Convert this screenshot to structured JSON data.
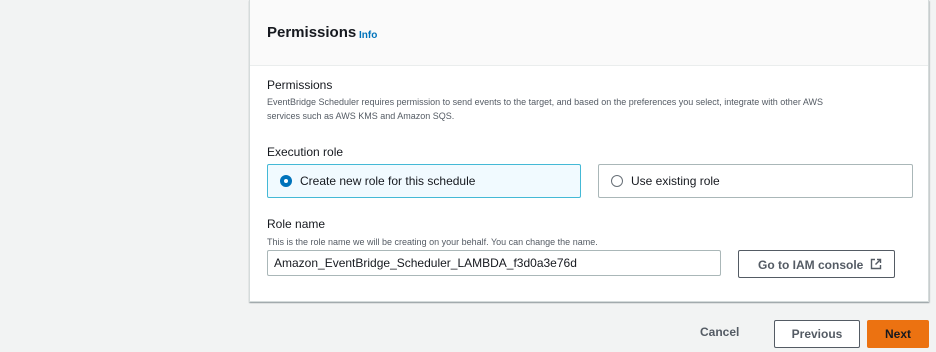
{
  "panel": {
    "title": "Permissions",
    "info_link": "Info"
  },
  "permissions": {
    "label": "Permissions",
    "description_line1": "EventBridge Scheduler requires permission to send events to the target, and based on the preferences you select, integrate with other AWS",
    "description_line2": "services such as AWS KMS and Amazon SQS."
  },
  "execution_role": {
    "label": "Execution role",
    "options": [
      {
        "label": "Create new role for this schedule",
        "selected": true
      },
      {
        "label": "Use existing role",
        "selected": false
      }
    ]
  },
  "role_name": {
    "label": "Role name",
    "description": "This is the role name we will be creating on your behalf. You can change the name.",
    "value": "Amazon_EventBridge_Scheduler_LAMBDA_f3d0a3e76d",
    "iam_button": "Go to IAM console",
    "iam_icon": "external-link-icon"
  },
  "footer": {
    "cancel": "Cancel",
    "previous": "Previous",
    "next": "Next"
  },
  "colors": {
    "accent": "#0073bb",
    "primary_button": "#ec7211",
    "selected_tile_border": "#44b9d6",
    "selected_tile_bg": "#f1faff"
  }
}
